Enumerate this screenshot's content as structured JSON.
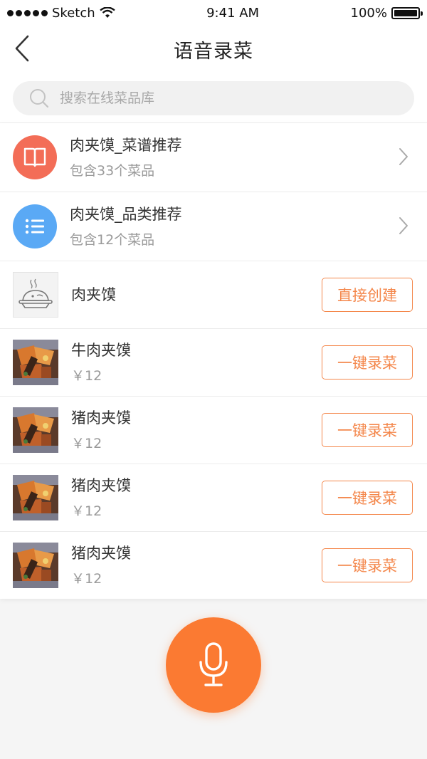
{
  "status_bar": {
    "carrier": "Sketch",
    "time": "9:41 AM",
    "battery": "100%"
  },
  "header": {
    "title": "语音录菜"
  },
  "search": {
    "placeholder": "搜索在线菜品库"
  },
  "recommendations": [
    {
      "title": "肉夹馍_菜谱推荐",
      "subtitle": "包含33个菜品",
      "icon": "book-icon",
      "color": "#f36d57"
    },
    {
      "title": "肉夹馍_品类推荐",
      "subtitle": "包含12个菜品",
      "icon": "list-icon",
      "color": "#5aa9f5"
    }
  ],
  "direct_create": {
    "name": "肉夹馍",
    "button": "直接创建",
    "icon": "dish-placeholder-icon"
  },
  "dishes": [
    {
      "name": "牛肉夹馍",
      "price": "￥12",
      "button": "一键录菜"
    },
    {
      "name": "猪肉夹馍",
      "price": "￥12",
      "button": "一键录菜"
    },
    {
      "name": "猪肉夹馍",
      "price": "￥12",
      "button": "一键录菜"
    },
    {
      "name": "猪肉夹馍",
      "price": "￥12",
      "button": "一键录菜"
    }
  ],
  "colors": {
    "accent": "#fb7a32",
    "button_border": "#f4874b"
  }
}
